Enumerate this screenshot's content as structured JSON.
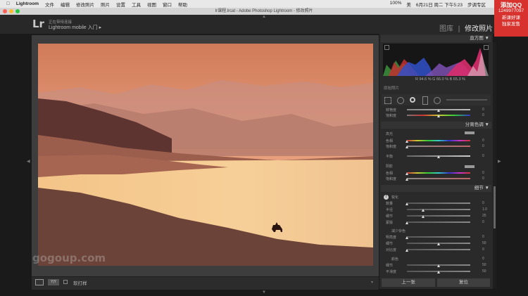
{
  "menubar": {
    "items": [
      "Lightroom",
      "文件",
      "编辑",
      "修改照片",
      "照片",
      "设置",
      "工具",
      "视图",
      "窗口",
      "帮助"
    ],
    "battery": "100%",
    "input_method": "美",
    "datetime": "6月21日 周二 下午5:23",
    "user": "步调专区"
  },
  "window": {
    "title": "Ir课程.lrcat - Adobe Photoshop Lightroom - 修改照片"
  },
  "promo": {
    "line1": "添加QQ",
    "line2": "1249977097",
    "line3": "新课好课",
    "line4": "独家发售"
  },
  "identity": {
    "logo": "Lr",
    "status": "正在带待连接",
    "title": "Lightroom mobile 入门 ▸"
  },
  "modules": {
    "library": "图库",
    "separator": "|",
    "develop": "修改照片"
  },
  "photo": {
    "watermark": "gogoup.com"
  },
  "toolbar": {
    "yy_label": "Y|Y",
    "soft_proof": "软打样"
  },
  "histogram": {
    "title": "直方图 ▼",
    "readout": "R 94.6 %  G 66.0 %  B 65.3 %",
    "original_photo": "原始照片"
  },
  "basic_tail": {
    "rows": [
      {
        "label": "鲜艳度",
        "value": "0",
        "pos": 0.5,
        "grad": "linear-gradient(90deg,#888,#bbb)"
      },
      {
        "label": "饱和度",
        "value": "0",
        "pos": 0.5,
        "grad": "linear-gradient(90deg,#777,#c33,#cc3,#3c3,#33c)"
      }
    ]
  },
  "split_toning": {
    "title": "分离色调 ▼",
    "highlights_label": "高光",
    "highlight_rows": [
      {
        "label": "色相",
        "value": "0",
        "pos": 0.0,
        "grad": "linear-gradient(90deg,#c33,#cc3,#3c3,#3cc,#33c,#c3c,#c33)"
      },
      {
        "label": "饱和度",
        "value": "0",
        "pos": 0.0,
        "grad": "linear-gradient(90deg,#888,#b66)"
      }
    ],
    "balance_label": "平衡",
    "balance_value": "0",
    "shadows_label": "阴影",
    "shadow_rows": [
      {
        "label": "色相",
        "value": "0",
        "pos": 0.0,
        "grad": "linear-gradient(90deg,#c33,#cc3,#3c3,#3cc,#33c,#c3c,#c33)"
      },
      {
        "label": "饱和度",
        "value": "0",
        "pos": 0.0,
        "grad": "linear-gradient(90deg,#888,#b66)"
      }
    ]
  },
  "detail": {
    "title": "细节 ▼",
    "sharpen_label": "锐化",
    "sharpen_rows": [
      {
        "label": "数量",
        "value": "0",
        "pos": 0.0
      },
      {
        "label": "半径",
        "value": "1.0",
        "pos": 0.25
      },
      {
        "label": "细节",
        "value": "25",
        "pos": 0.25
      },
      {
        "label": "蒙版",
        "value": "0",
        "pos": 0.0
      }
    ],
    "noise_label": "减少杂色",
    "noise_rows": [
      {
        "label": "明亮度",
        "value": "0",
        "pos": 0.0
      },
      {
        "label": "细节",
        "value": "50",
        "pos": 0.5
      },
      {
        "label": "对比度",
        "value": "0",
        "pos": 0.0
      }
    ],
    "color_label": "颜色",
    "color_value": "0",
    "color_rows": [
      {
        "label": "细节",
        "value": "50",
        "pos": 0.5
      },
      {
        "label": "平滑度",
        "value": "50",
        "pos": 0.5
      }
    ]
  },
  "buttons": {
    "previous": "上一张",
    "reset": "复位"
  },
  "colors": {
    "accent_red": "#d8322e",
    "panel_bg": "#2a2a2a",
    "work_bg": "#3d3d3d"
  }
}
